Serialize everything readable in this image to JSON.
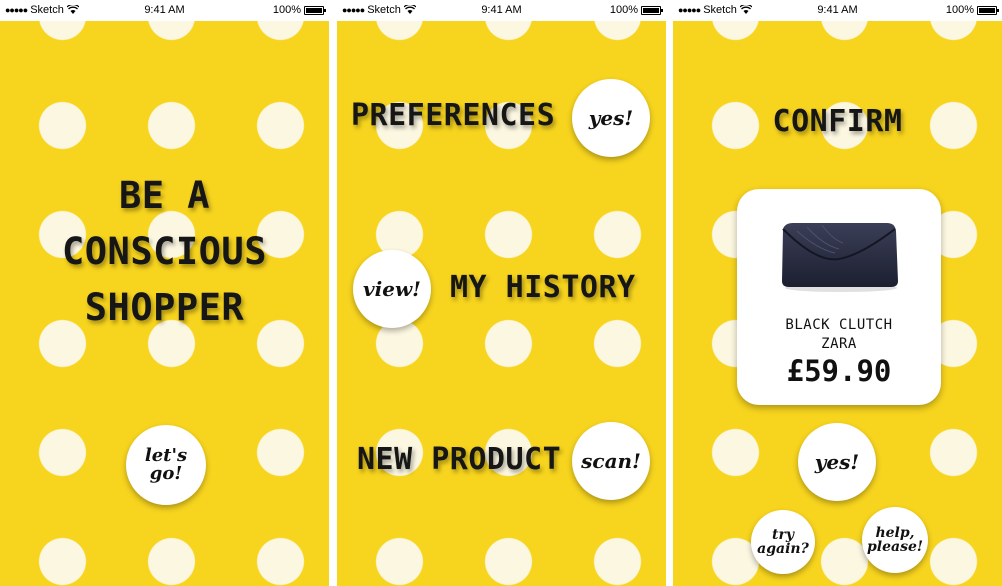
{
  "statusbar": {
    "carrier": "Sketch",
    "time": "9:41 AM",
    "battery": "100%"
  },
  "screen1": {
    "headline": [
      "BE A",
      "CONSCIOUS",
      "SHOPPER"
    ],
    "go_button": [
      "let's",
      "go!"
    ]
  },
  "screen2": {
    "preferences_label": "PREFERENCES",
    "preferences_button": "yes!",
    "history_button": "view!",
    "history_label": "MY HISTORY",
    "new_product_label": "NEW PRODUCT",
    "scan_button": "scan!"
  },
  "screen3": {
    "title": "CONFIRM",
    "product": {
      "name": "BLACK CLUTCH",
      "brand": "ZARA",
      "price": "£59.90"
    },
    "confirm_button": "yes!",
    "try_again_button": [
      "try",
      "again?"
    ],
    "help_button": [
      "help,",
      "please!"
    ]
  },
  "colors": {
    "background": "#f7d41e",
    "dots": "#fcf7e1",
    "text": "#161616",
    "button": "#ffffff"
  }
}
